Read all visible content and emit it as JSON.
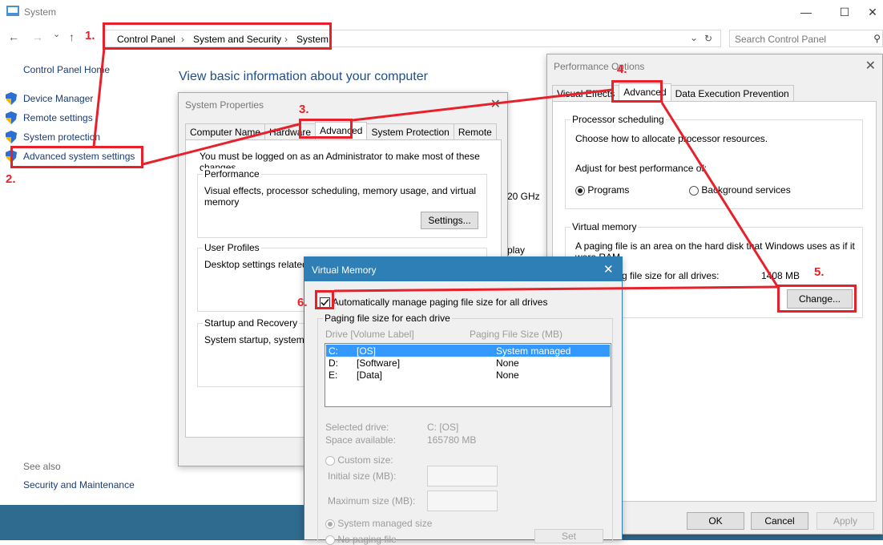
{
  "window": {
    "title": "System",
    "minimize": "—",
    "maximize": "☐",
    "close": "✕",
    "nav_back": "←",
    "nav_forward": "→",
    "nav_recent": "⌄",
    "nav_up": "↑",
    "breadcrumb": [
      "Control Panel",
      "System and Security",
      "System"
    ],
    "breadcrumb_sep": "›",
    "search_placeholder": "Search Control Panel"
  },
  "sidebar": {
    "home": "Control Panel Home",
    "items": [
      "Device Manager",
      "Remote settings",
      "System protection",
      "Advanced system settings"
    ],
    "see_also_label": "See also",
    "see_also_items": [
      "Security and Maintenance"
    ]
  },
  "main": {
    "heading": "View basic information about your computer",
    "fragments": [
      "20 GHz",
      "play"
    ]
  },
  "system_properties": {
    "title": "System Properties",
    "tabs": [
      "Computer Name",
      "Hardware",
      "Advanced",
      "System Protection",
      "Remote"
    ],
    "notice": "You must be logged on as an Administrator to make most of these changes.",
    "performance": {
      "label": "Performance",
      "text": "Visual effects, processor scheduling, memory usage, and virtual memory",
      "button": "Settings..."
    },
    "user_profiles": {
      "label": "User Profiles",
      "text": "Desktop settings related to"
    },
    "startup": {
      "label": "Startup and Recovery",
      "text": "System startup, system failu"
    }
  },
  "performance_options": {
    "title": "Performance Options",
    "tabs": [
      "Visual Effects",
      "Advanced",
      "Data Execution Prevention"
    ],
    "processor": {
      "label": "Processor scheduling",
      "desc": "Choose how to allocate processor resources.",
      "adjust": "Adjust for best performance of:",
      "programs": "Programs",
      "background": "Background services"
    },
    "virtual_memory": {
      "label": "Virtual memory",
      "desc": "A paging file is an area on the hard disk that Windows uses as if it were RAM.",
      "total_label": "Total paging file size for all drives:",
      "total_value": "1408 MB",
      "button": "Change..."
    },
    "ok": "OK",
    "cancel": "Cancel",
    "apply": "Apply"
  },
  "virtual_memory": {
    "title": "Virtual Memory",
    "auto_manage": "Automatically manage paging file size for all drives",
    "auto_checked": true,
    "group_label": "Paging file size for each drive",
    "col_drive": "Drive  [Volume Label]",
    "col_size": "Paging File Size (MB)",
    "drives": [
      {
        "drive": "C:",
        "label": "[OS]",
        "size": "System managed"
      },
      {
        "drive": "D:",
        "label": "[Software]",
        "size": "None"
      },
      {
        "drive": "E:",
        "label": "[Data]",
        "size": "None"
      }
    ],
    "selected_drive_label": "Selected drive:",
    "selected_drive_value": "C:  [OS]",
    "space_label": "Space available:",
    "space_value": "165780 MB",
    "custom_size": "Custom size:",
    "initial_size": "Initial size (MB):",
    "maximum_size": "Maximum size (MB):",
    "system_managed": "System managed size",
    "no_paging": "No paging file",
    "set_button": "Set"
  },
  "annotations": [
    "1.",
    "2.",
    "3.",
    "4.",
    "5.",
    "6."
  ],
  "colors": {
    "annotation_red": "#e8202a",
    "link_blue": "#1a3c75",
    "heading_blue": "#1e4f8c",
    "vm_titlebar": "#2e7fb5",
    "selection": "#3399ff"
  }
}
